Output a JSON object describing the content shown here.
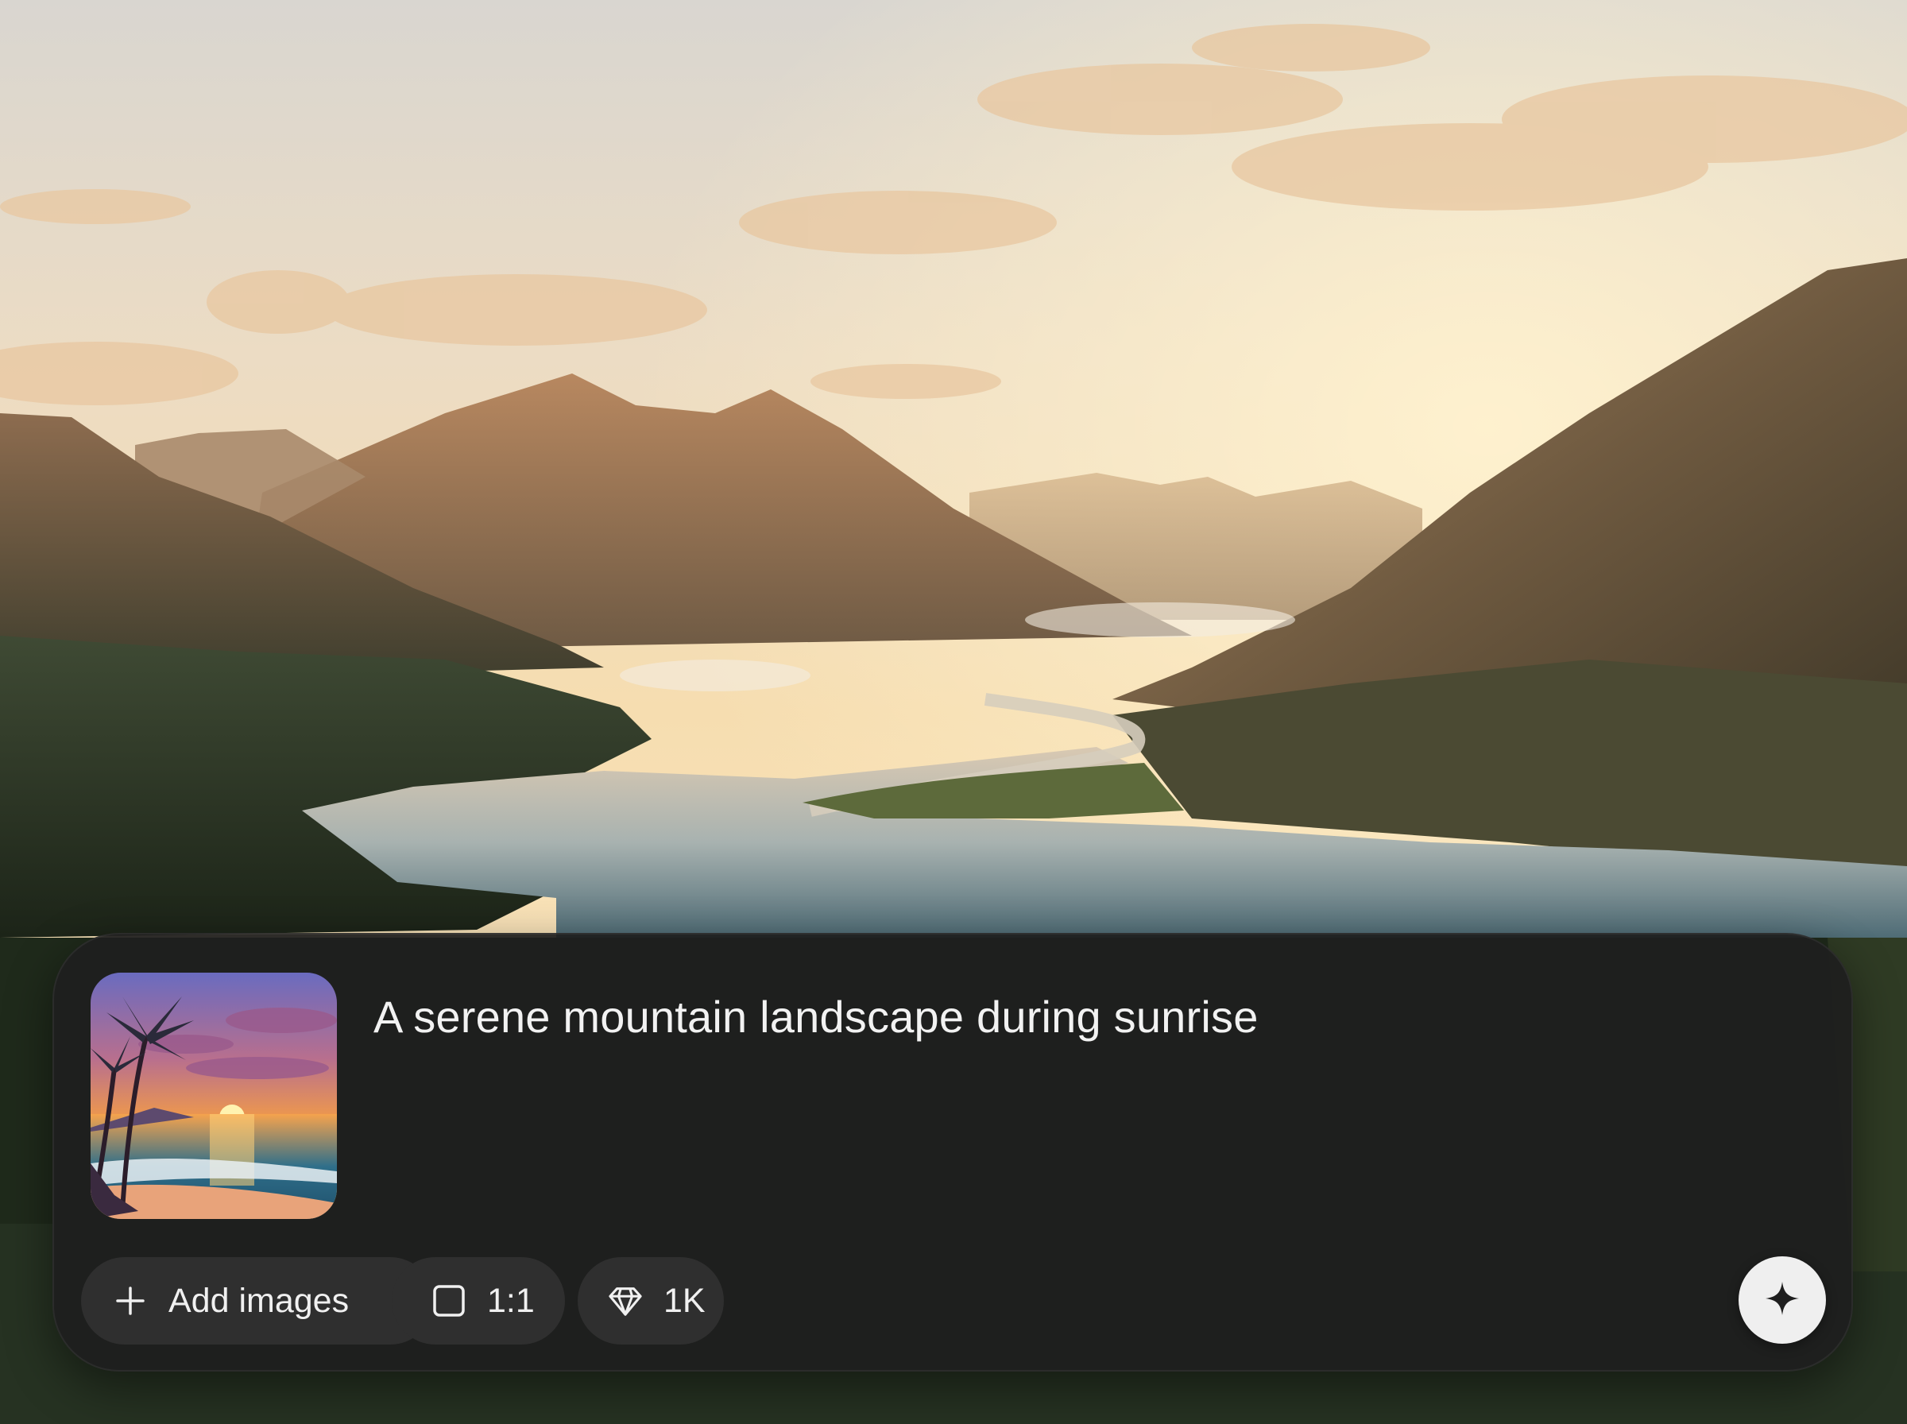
{
  "prompt": {
    "text": "A serene mountain landscape during sunrise"
  },
  "toolbar": {
    "add_images_label": "Add images",
    "aspect_ratio_label": "1:1",
    "quality_label": "1K"
  },
  "icons": {
    "add": "plus-icon",
    "aspect_ratio": "square-icon",
    "quality": "diamond-icon",
    "submit": "sparkle-icon"
  },
  "colors": {
    "composer_background": "#1e1e1e",
    "chip_background": "#2f2f2f",
    "text": "#f2f2f2",
    "submit_button": "#efefef"
  }
}
